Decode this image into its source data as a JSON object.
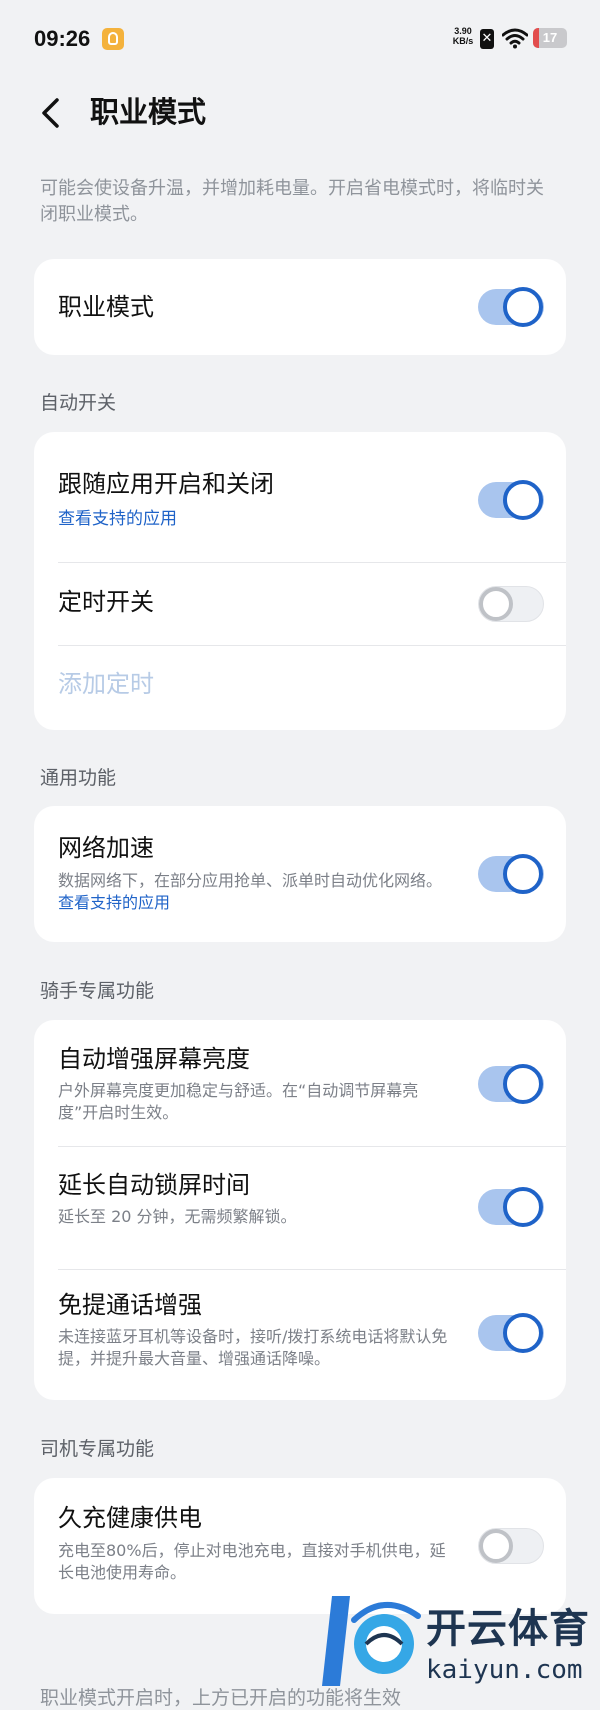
{
  "status_bar": {
    "time": "09:26",
    "net_speed_value": "3.90",
    "net_speed_unit": "KB/s",
    "battery_level": "17",
    "battery_fraction": 0.17
  },
  "header": {
    "title": "职业模式"
  },
  "intro": "可能会使设备升温，并增加耗电量。开启省电模式时，将临时关闭职业模式。",
  "main_toggle": {
    "title": "职业模式",
    "on": true
  },
  "auto_switch": {
    "section_title": "自动开关",
    "follow_app": {
      "title": "跟随应用开启和关闭",
      "link": "查看支持的应用",
      "on": true
    },
    "timer": {
      "title": "定时开关",
      "on": false
    },
    "add_timer": "添加定时"
  },
  "general": {
    "section_title": "通用功能",
    "network_boost": {
      "title": "网络加速",
      "desc": "数据网络下，在部分应用抢单、派单时自动优化网络。",
      "link": "查看支持的应用",
      "on": true
    }
  },
  "rider": {
    "section_title": "骑手专属功能",
    "brightness": {
      "title": "自动增强屏幕亮度",
      "desc": "户外屏幕亮度更加稳定与舒适。在“自动调节屏幕亮度”开启时生效。",
      "on": true
    },
    "lock_time": {
      "title": "延长自动锁屏时间",
      "desc": "延长至 20 分钟，无需频繁解锁。",
      "on": true
    },
    "handsfree": {
      "title": "免提通话增强",
      "desc": "未连接蓝牙耳机等设备时，接听/拨打系统电话将默认免提，并提升最大音量、增强通话降噪。",
      "on": true
    }
  },
  "driver": {
    "section_title": "司机专属功能",
    "charging": {
      "title": "久充健康供电",
      "desc": "充电至80%后，停止对电池充电，直接对手机供电，延长电池使用寿命。",
      "on": false
    }
  },
  "footer": "职业模式开启时，上方已开启的功能将生效",
  "watermark": {
    "text": "开云体育",
    "sub": "kaiyun.com"
  }
}
